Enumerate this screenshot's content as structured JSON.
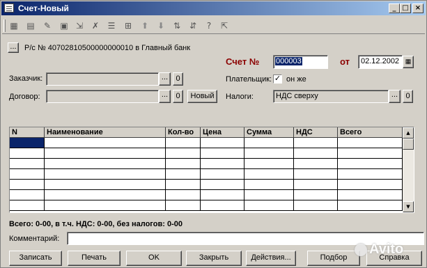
{
  "window": {
    "title": "Счет-Новый"
  },
  "titlebar_buttons": {
    "minimize": "_",
    "maximize": "□",
    "close": "×"
  },
  "toolbar": {
    "icons": [
      "new-row-icon",
      "copy-row-icon",
      "edit-row-icon",
      "delete-row-icon",
      "move-icon",
      "mark-icon",
      "group-icon",
      "up-arrow-icon",
      "down-arrow-icon",
      "sort-icon",
      "help-icon",
      "what-is-icon"
    ]
  },
  "header": {
    "account_button": "...",
    "account_text": "Р/с № 40702810500000000010 в Главный банк",
    "invoice_label": "Счет №",
    "invoice_number": "000003",
    "date_label": "от",
    "date_value": "02.12.2002"
  },
  "form": {
    "customer_label": "Заказчик:",
    "customer_value": "",
    "contract_label": "Договор:",
    "contract_value": "",
    "new_button": "Новый",
    "payer_label": "Плательщик:",
    "payer_checkbox_text": "он же",
    "payer_checked": true,
    "taxes_label": "Налоги:",
    "taxes_value": "НДС сверху",
    "select_button": "...",
    "clear_button": "0"
  },
  "table": {
    "columns": [
      "N",
      "Наименование",
      "Кол-во",
      "Цена",
      "Сумма",
      "НДС",
      "Всего"
    ],
    "rows": [
      [
        "",
        "",
        "",
        "",
        "",
        "",
        ""
      ]
    ]
  },
  "totals": {
    "text": "Всего: 0-00, в т.ч. НДС: 0-00, без налогов: 0-00"
  },
  "comment": {
    "label": "Комментарий:",
    "value": ""
  },
  "buttons": {
    "record": "Записать",
    "print": "Печать",
    "ok": "OK",
    "close": "Закрыть",
    "actions": "Действия...",
    "select": "Подбор",
    "help": "Справка"
  },
  "watermark": {
    "text": "Avito"
  }
}
